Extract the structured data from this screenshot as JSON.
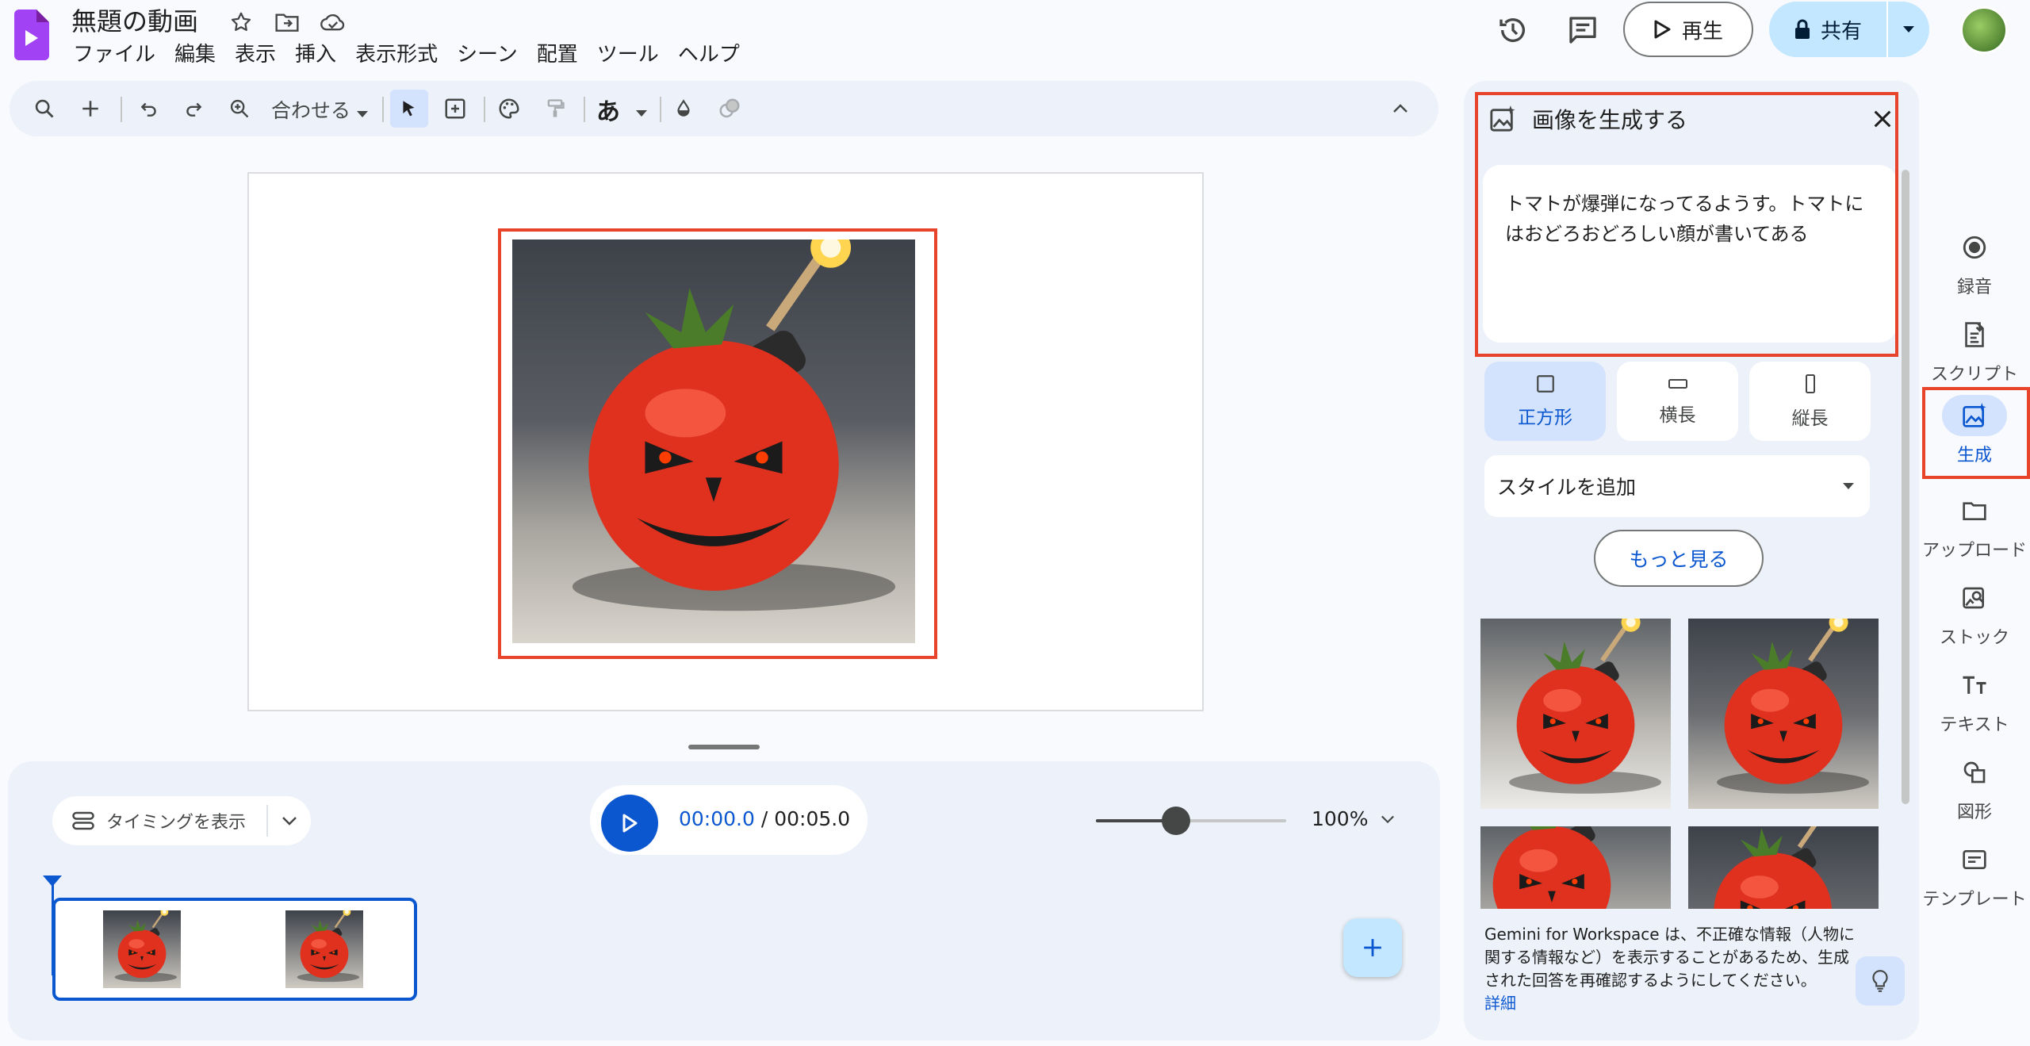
{
  "app": {
    "title": "無題の動画",
    "menu": [
      "ファイル",
      "編集",
      "表示",
      "挿入",
      "表示形式",
      "シーン",
      "配置",
      "ツール",
      "ヘルプ"
    ],
    "play_label": "再生",
    "share_label": "共有"
  },
  "toolbar": {
    "zoom_label": "合わせる",
    "text_style_label": "あ"
  },
  "timeline": {
    "timing_label": "タイミングを表示",
    "current_time": "00:00.0",
    "total_time": "/ 00:05.0",
    "zoom_percent": "100%",
    "zoom_level": 0.42
  },
  "panel": {
    "title": "画像を生成する",
    "prompt": "トマトが爆弾になってるようす。トマトにはおどろおどろしい顔が書いてある",
    "ratios": [
      "正方形",
      "横長",
      "縦長"
    ],
    "selected_ratio": "正方形",
    "style_placeholder": "スタイルを追加",
    "more_label": "もっと見る",
    "disclaimer": "Gemini for Workspace は、不正確な情報（人物に関する情報など）を表示することがあるため、生成された回答を再確認するようにしてください。",
    "details_link": "詳細"
  },
  "rail": [
    {
      "label": "録音",
      "icon": "record-icon"
    },
    {
      "label": "スクリプト",
      "icon": "script-icon"
    },
    {
      "label": "生成",
      "icon": "generate-image-icon",
      "active": true
    },
    {
      "label": "アップロード",
      "icon": "folder-icon"
    },
    {
      "label": "ストック",
      "icon": "stock-icon"
    },
    {
      "label": "テキスト",
      "icon": "text-icon"
    },
    {
      "label": "図形",
      "icon": "shapes-icon"
    },
    {
      "label": "テンプレート",
      "icon": "template-icon"
    }
  ],
  "colors": {
    "accent": "#0b57d0",
    "highlight": "#e8432b",
    "share_bg": "#c2e7ff"
  }
}
